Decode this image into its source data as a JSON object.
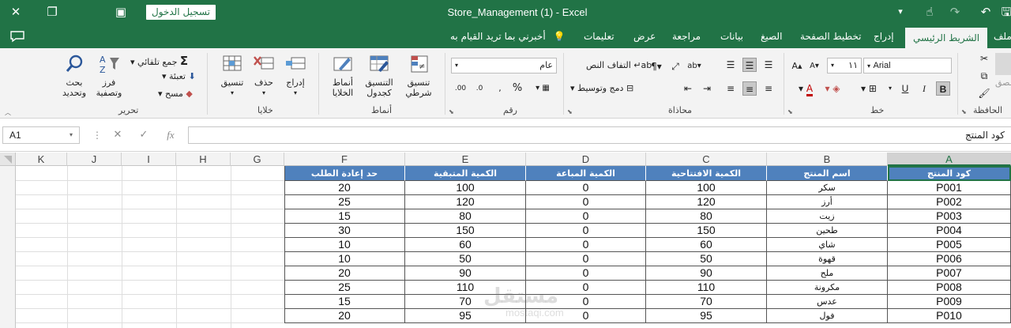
{
  "window": {
    "title": "Store_Management (1)  -  Excel",
    "signin_label": "تسجيل الدخول"
  },
  "tabs": [
    {
      "label": "الشريط الرئيسي",
      "active": true
    },
    {
      "label": "إدراج"
    },
    {
      "label": "تخطيط الصفحة"
    },
    {
      "label": "الصيغ"
    },
    {
      "label": "بيانات"
    },
    {
      "label": "مراجعة"
    },
    {
      "label": "عرض"
    },
    {
      "label": "تعليمات"
    }
  ],
  "tab_partial": "ملف",
  "tell_me": "أخبرني بما تريد القيام به",
  "ribbon": {
    "clipboard": {
      "label": "الحافظة",
      "paste": "لصق"
    },
    "font": {
      "label": "خط",
      "font_name": "Arial",
      "font_size": "١١",
      "bold": "B",
      "italic": "I",
      "underline": "U"
    },
    "alignment": {
      "label": "محاذاة",
      "wrap": "التفاف النص",
      "merge": "دمج وتوسيط"
    },
    "number": {
      "label": "رقم",
      "format": "عام",
      "percent": "%"
    },
    "styles": {
      "label": "أنماط",
      "conditional": "تنسيق\nشرطي",
      "conditional_1": "تنسيق",
      "conditional_2": "شرطي",
      "table_1": "التنسيق",
      "table_2": "كجدول",
      "cell_1": "أنماط",
      "cell_2": "الخلايا"
    },
    "cells": {
      "label": "خلايا",
      "insert": "إدراج",
      "delete": "حذف",
      "format": "تنسيق"
    },
    "editing": {
      "label": "تحرير",
      "autosum": "جمع تلقائي",
      "fill": "تعبئة",
      "clear": "مسح",
      "sort_1": "فرز",
      "sort_2": "وتصفية",
      "find_1": "بحث",
      "find_2": "وتحديد"
    }
  },
  "formula_bar": {
    "name_box": "A1",
    "fx": "fx",
    "content": "كود المنتج"
  },
  "columns": [
    "A",
    "B",
    "C",
    "D",
    "E",
    "F",
    "G",
    "H",
    "I",
    "J",
    "K"
  ],
  "selected_column": "A",
  "table": {
    "headers": [
      "كود المنتج",
      "اسم المنتج",
      "الكمية الافتتاحية",
      "الكمية المباعة",
      "الكمية المتبقية",
      "حد إعادة الطلب"
    ],
    "rows": [
      [
        "P001",
        "سكر",
        "100",
        "0",
        "100",
        "20"
      ],
      [
        "P002",
        "أرز",
        "120",
        "0",
        "120",
        "25"
      ],
      [
        "P003",
        "زيت",
        "80",
        "0",
        "80",
        "15"
      ],
      [
        "P004",
        "طحين",
        "150",
        "0",
        "150",
        "30"
      ],
      [
        "P005",
        "شاي",
        "60",
        "0",
        "60",
        "10"
      ],
      [
        "P006",
        "قهوة",
        "50",
        "0",
        "50",
        "10"
      ],
      [
        "P007",
        "ملح",
        "90",
        "0",
        "90",
        "20"
      ],
      [
        "P008",
        "مكرونة",
        "110",
        "0",
        "110",
        "25"
      ],
      [
        "P009",
        "عدس",
        "70",
        "0",
        "70",
        "15"
      ],
      [
        "P010",
        "فول",
        "95",
        "0",
        "95",
        "20"
      ]
    ]
  },
  "watermark": {
    "main": "مستقل",
    "sub": "mostaqi.com"
  },
  "colors": {
    "excel_green": "#217346",
    "header_blue": "#4f81bd"
  }
}
